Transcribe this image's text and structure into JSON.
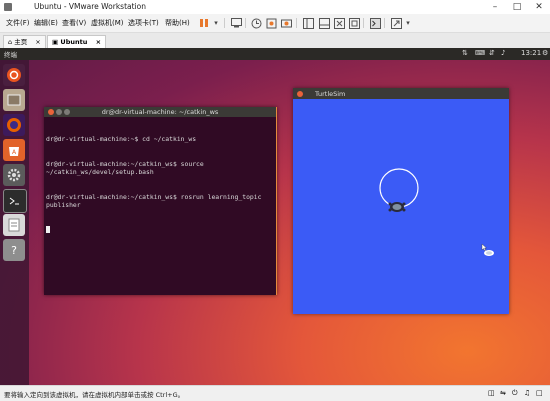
{
  "window": {
    "title": "Ubuntu - VMware Workstation"
  },
  "menubar": {
    "items": [
      "文件(F)",
      "编辑(E)",
      "查看(V)",
      "虚拟机(M)",
      "选项卡(T)",
      "帮助(H)"
    ]
  },
  "tabs": [
    {
      "label": "主页"
    },
    {
      "label": "Ubuntu"
    }
  ],
  "desktop": {
    "topbar_label": "终端",
    "clock": "13:21"
  },
  "terminal": {
    "title": "dr@dr-virtual-machine: ~/catkin_ws",
    "lines": [
      "dr@dr-virtual-machine:~$ cd ~/catkin_ws",
      "dr@dr-virtual-machine:~/catkin_ws$ source ~/catkin_ws/devel/setup.bash",
      "dr@dr-virtual-machine:~/catkin_ws$ rosrun learning_topic publisher"
    ]
  },
  "turtlesim": {
    "title": "TurtleSim",
    "background": "#3b5bf6"
  },
  "statusbar": {
    "message": "要将输入定向到该虚拟机，请在虚拟机内部单击或按 Ctrl+G。"
  },
  "colors": {
    "terminal_bg": "#300a24",
    "accent_orange": "#e8623a"
  }
}
